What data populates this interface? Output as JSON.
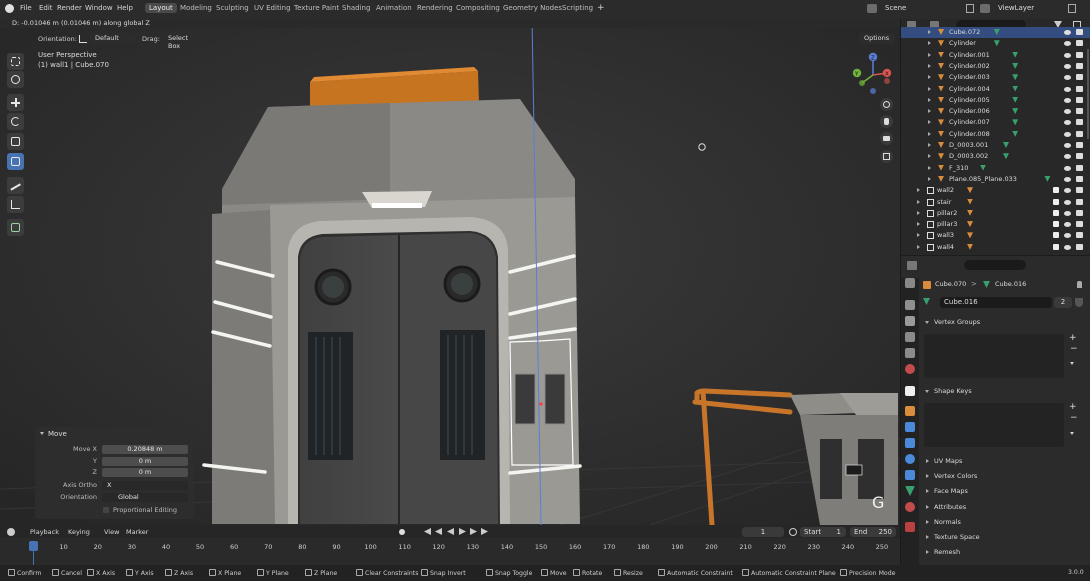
{
  "topbar": {
    "menus": [
      "File",
      "Edit",
      "Render",
      "Window",
      "Help"
    ],
    "workspaces": [
      "Layout",
      "Modeling",
      "Sculpting",
      "UV Editing",
      "Texture Paint",
      "Shading",
      "Animation",
      "Rendering",
      "Compositing",
      "Geometry Nodes",
      "Scripting"
    ],
    "active_workspace": "Layout",
    "add_workspace": "+",
    "scene": "Scene",
    "view_layer": "ViewLayer"
  },
  "viewport": {
    "status_message": "D: -0.01046 m (0.01046 m) along global Z",
    "orientation_label": "Orientation:",
    "orientation_value": "Default",
    "drag_label": "Drag:",
    "drag_value": "Select Box",
    "options": "Options",
    "view_name": "User Perspective",
    "object_info": "(1) wall1 | Cube.070",
    "gizmo_key": "G",
    "gizmo_axes": [
      "X",
      "Y",
      "Z"
    ]
  },
  "move_panel": {
    "title": "Move",
    "move_x_label": "Move X",
    "move_x": "0.20848 m",
    "y_label": "Y",
    "y": "0 m",
    "z_label": "Z",
    "z": "0 m",
    "axis_ortho_label": "Axis Ortho",
    "axis_ortho": "X",
    "orientation_label": "Orientation",
    "orientation": "Global",
    "proportional_editing": "Proportional Editing"
  },
  "outliner": {
    "search_placeholder": "",
    "rows": [
      {
        "name": "Cube.072",
        "kind": "mesh"
      },
      {
        "name": "Cylinder",
        "kind": "mesh"
      },
      {
        "name": "Cylinder.001",
        "kind": "mesh"
      },
      {
        "name": "Cylinder.002",
        "kind": "mesh"
      },
      {
        "name": "Cylinder.003",
        "kind": "mesh"
      },
      {
        "name": "Cylinder.004",
        "kind": "mesh"
      },
      {
        "name": "Cylinder.005",
        "kind": "mesh"
      },
      {
        "name": "Cylinder.006",
        "kind": "mesh"
      },
      {
        "name": "Cylinder.007",
        "kind": "mesh"
      },
      {
        "name": "Cylinder.008",
        "kind": "mesh"
      },
      {
        "name": "D_0003.001",
        "kind": "mesh"
      },
      {
        "name": "D_0003.002",
        "kind": "mesh"
      },
      {
        "name": "F_310",
        "kind": "mesh"
      },
      {
        "name": "Plane.085_Plane.033",
        "kind": "mesh"
      },
      {
        "name": "wall2",
        "kind": "collection"
      },
      {
        "name": "stair",
        "kind": "collection"
      },
      {
        "name": "pillar2",
        "kind": "collection"
      },
      {
        "name": "pillar3",
        "kind": "collection"
      },
      {
        "name": "wall3",
        "kind": "collection"
      },
      {
        "name": "wall4",
        "kind": "collection"
      }
    ]
  },
  "properties": {
    "breadcrumb_object": "Cube.070",
    "breadcrumb_data": "Cube.016",
    "mesh_name": "Cube.016",
    "users": "2",
    "sections": [
      "Vertex Groups",
      "Shape Keys",
      "UV Maps",
      "Vertex Colors",
      "Face Maps",
      "Attributes",
      "Normals",
      "Texture Space",
      "Remesh"
    ],
    "list_add": "+",
    "list_remove": "−"
  },
  "timeline": {
    "playback": "Playback",
    "keying": "Keying",
    "view": "View",
    "marker": "Marker",
    "current_frame": "1",
    "start_label": "Start",
    "start": "1",
    "end_label": "End",
    "end": "250",
    "ticks": [
      "1",
      "10",
      "20",
      "30",
      "40",
      "50",
      "60",
      "70",
      "80",
      "90",
      "100",
      "110",
      "120",
      "130",
      "140",
      "150",
      "160",
      "170",
      "180",
      "190",
      "200",
      "210",
      "220",
      "230",
      "240",
      "250"
    ]
  },
  "statusbar": {
    "items": [
      "Confirm",
      "Cancel",
      "X Axis",
      "Y Axis",
      "Z Axis",
      "X Plane",
      "Y Plane",
      "Z Plane",
      "Clear Constraints",
      "Snap Invert",
      "Snap Toggle",
      "Move",
      "Rotate",
      "Resize",
      "Automatic Constraint",
      "Automatic Constraint Plane",
      "Precision Mode"
    ],
    "version": "3.0.0"
  },
  "colors": {
    "accent": "#4772b3",
    "object_orange": "#d98c3c",
    "mesh_green": "#37a06e",
    "background": "#303030"
  }
}
